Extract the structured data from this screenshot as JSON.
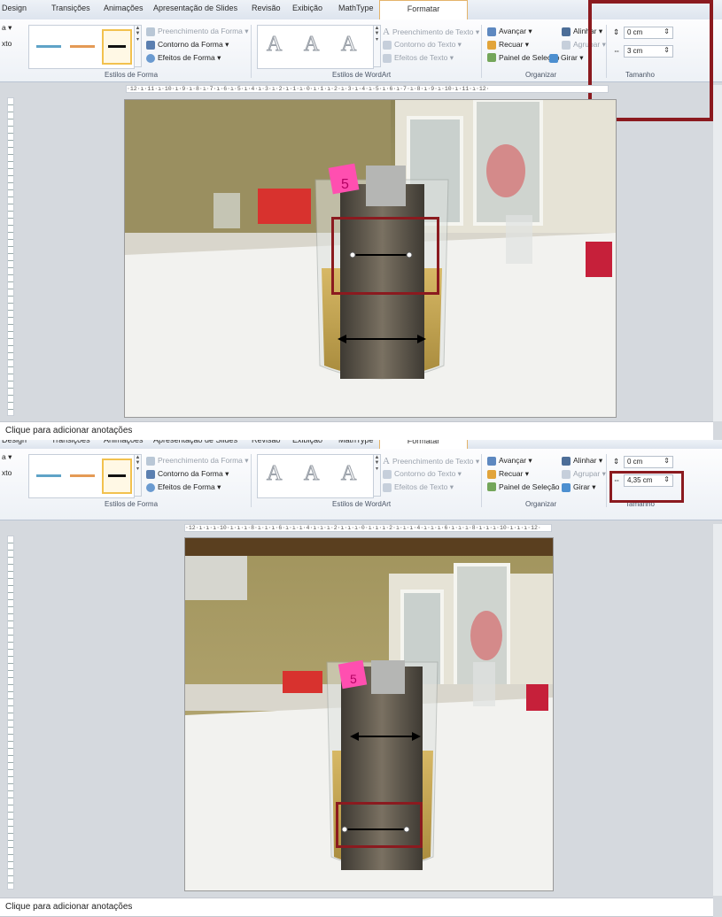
{
  "tabs": [
    "Design",
    "Transições",
    "Animações",
    "Apresentação de Slides",
    "Revisão",
    "Exibição",
    "MathType",
    "Formatar"
  ],
  "left_cut": {
    "top": "a ▾",
    "bottom": "xto"
  },
  "groups": {
    "forma": "Estilos de Forma",
    "wordart": "Estilos de WordArt",
    "organizar": "Organizar",
    "tamanho": "Tamanho"
  },
  "shape_cmds": {
    "preenchimento": "Preenchimento da Forma ▾",
    "contorno": "Contorno da Forma ▾",
    "efeitos": "Efeitos de Forma ▾"
  },
  "text_cmds": {
    "preenchimento": "Preenchimento de Texto ▾",
    "contorno": "Contorno do Texto ▾",
    "efeitos": "Efeitos de Texto ▾"
  },
  "org_cmds": {
    "avancar": "Avançar ▾",
    "recuar": "Recuar ▾",
    "painel": "Painel de Seleção",
    "alinhar": "Alinhar ▾",
    "agrupar": "Agrupar ▾",
    "girar": "Girar ▾"
  },
  "size": {
    "p1_height": "0 cm",
    "p1_width": "3 cm",
    "p2_height": "0 cm",
    "p2_width": "4,35 cm"
  },
  "wordart_letter": "A",
  "ruler_p1": "·12·ı·11·ı·10·ı·9·ı·8·ı·7·ı·6·ı·5·ı·4·ı·3·ı·2·ı·1·ı·0·ı·1·ı·2·ı·3·ı·4·ı·5·ı·6·ı·7·ı·8·ı·9·ı·10·ı·11·ı·12·",
  "ruler_p2": "·12·ı·ı·ı·10·ı·ı·ı·8·ı·ı·ı·6·ı·ı·ı·4·ı·ı·ı·2·ı·ı·ı·0·ı·ı·ı·2·ı·ı·ı·4·ı·ı·ı·6·ı·ı·ı·8·ı·ı·ı·10·ı·ı·ı·12·",
  "notes": "Clique para adicionar anotações",
  "label_number": "5",
  "colors": {
    "highlight": "#8b1a1f",
    "accent": "#e4b46a",
    "label_pink": "#ff4fb0"
  }
}
